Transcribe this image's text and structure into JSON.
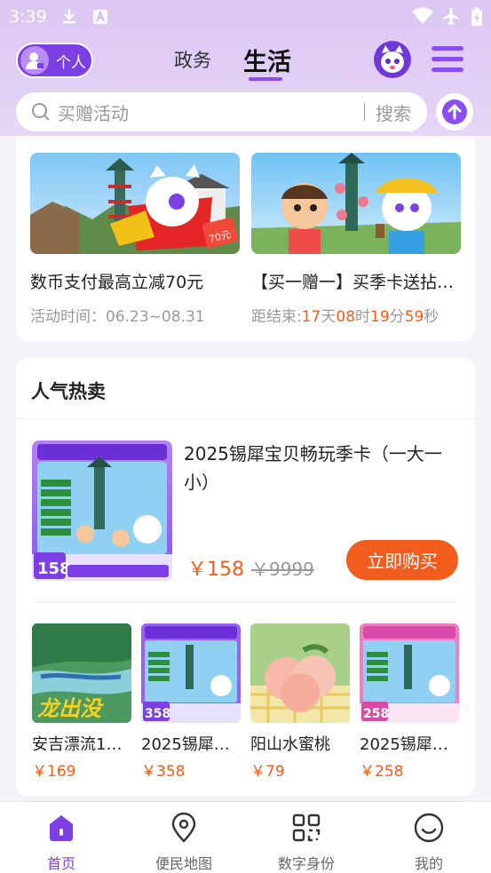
{
  "status_bar": {
    "time": "3:39"
  },
  "header": {
    "personal_label": "个人",
    "tabs": [
      {
        "label": "政务"
      },
      {
        "label": "生活"
      }
    ],
    "active_tab": "生活"
  },
  "search": {
    "placeholder": "买赠活动",
    "button_label": "搜索"
  },
  "activities": [
    {
      "title": "数币支付最高立减70元",
      "sub_prefix": "活动时间：",
      "sub_value": "06.23~08.31",
      "badge": "70元"
    },
    {
      "title": "【买一赠一】买季卡送拈…",
      "countdown_prefix": "距结束:",
      "days": "17",
      "days_unit": "天",
      "hours": "08",
      "hours_unit": "时",
      "minutes": "19",
      "minutes_unit": "分",
      "seconds": "59",
      "seconds_unit": "秒"
    }
  ],
  "hot": {
    "heading": "人气热卖",
    "featured": {
      "title": "2025锡犀宝贝畅玩季卡（一大一小）",
      "price": "￥158",
      "original_price": "￥9999",
      "buy_label": "立即购买",
      "image_price": "158"
    },
    "products": [
      {
        "name": "安吉漂流1…",
        "price": "￥169"
      },
      {
        "name": "2025锡犀…",
        "price": "￥358"
      },
      {
        "name": "阳山水蜜桃",
        "price": "￥79"
      },
      {
        "name": "2025锡犀…",
        "price": "￥258"
      }
    ]
  },
  "bottom_nav": [
    {
      "label": "首页",
      "active": true
    },
    {
      "label": "便民地图"
    },
    {
      "label": "数字身份"
    },
    {
      "label": "我的"
    }
  ],
  "colors": {
    "accent": "#7b3fe4",
    "price": "#f25c1c",
    "header_bg": "#dcc6f3"
  }
}
